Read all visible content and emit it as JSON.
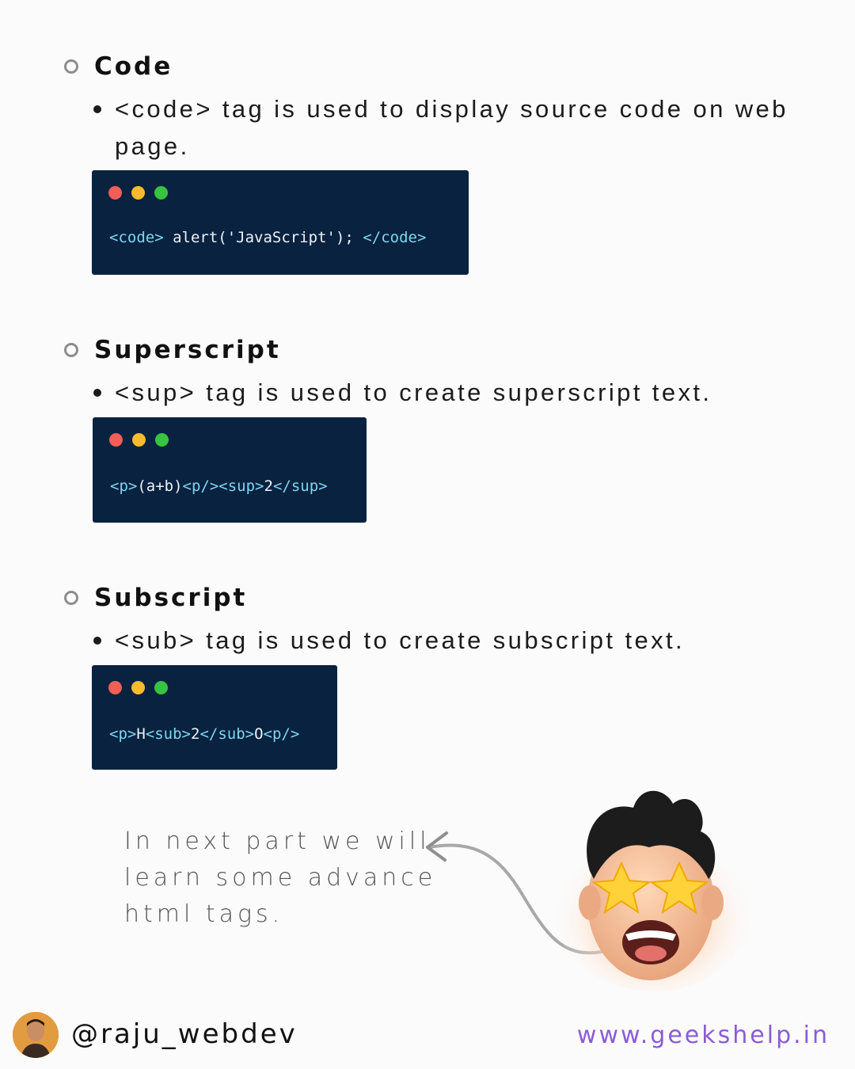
{
  "sections": [
    {
      "title": "Code",
      "description": "<code> tag is used to display source code on web page.",
      "code": {
        "open": "<code>",
        "body": " alert('JavaScript'); ",
        "close": "</code>"
      }
    },
    {
      "title": "Superscript",
      "description": "<sup> tag is used to create superscript text.",
      "code": {
        "p_open": "<p>",
        "body": "(a+b)",
        "p_close": "<p/>",
        "sup_open": "<sup>",
        "num": "2",
        "sup_close": "</sup>"
      }
    },
    {
      "title": "Subscript",
      "description": "<sub> tag is used to create subscript text.",
      "code": {
        "p_open": "<p>",
        "h": "H",
        "sub_open": "<sub>",
        "num": "2",
        "sub_close": "</sub>",
        "o": "O",
        "p_close": "<p/>"
      }
    }
  ],
  "note": {
    "line1": "In next part we will",
    "line2": "learn some advance",
    "line3": "html tags."
  },
  "footer": {
    "handle": "@raju_webdev",
    "website": "www.geekshelp.in"
  },
  "colors": {
    "code_bg": "#08223f",
    "tag_color": "#7fd6f0",
    "website_color": "#8a5cd6"
  },
  "icons": [
    "hollow-bullet-icon",
    "traffic-light-icon",
    "curved-arrow-icon",
    "memoji-star-eyes",
    "avatar"
  ]
}
